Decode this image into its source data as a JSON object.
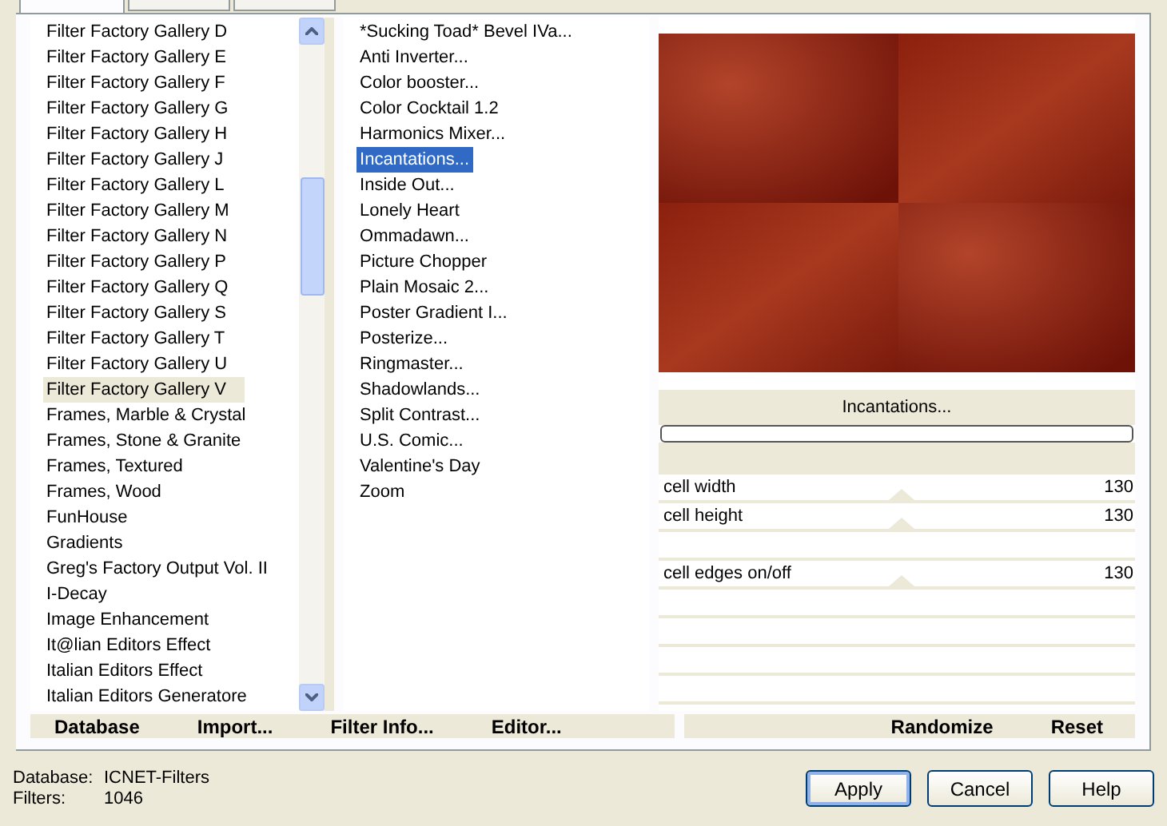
{
  "tabs": [
    {
      "selected": true
    },
    {
      "selected": false
    },
    {
      "selected": false
    }
  ],
  "categories": {
    "items": [
      {
        "label": "Filter Factory Gallery D",
        "selected": false
      },
      {
        "label": "Filter Factory Gallery E",
        "selected": false
      },
      {
        "label": "Filter Factory Gallery F",
        "selected": false
      },
      {
        "label": "Filter Factory Gallery G",
        "selected": false
      },
      {
        "label": "Filter Factory Gallery H",
        "selected": false
      },
      {
        "label": "Filter Factory Gallery J",
        "selected": false
      },
      {
        "label": "Filter Factory Gallery L",
        "selected": false
      },
      {
        "label": "Filter Factory Gallery M",
        "selected": false
      },
      {
        "label": "Filter Factory Gallery N",
        "selected": false
      },
      {
        "label": "Filter Factory Gallery P",
        "selected": false
      },
      {
        "label": "Filter Factory Gallery Q",
        "selected": false
      },
      {
        "label": "Filter Factory Gallery S",
        "selected": false
      },
      {
        "label": "Filter Factory Gallery T",
        "selected": false
      },
      {
        "label": "Filter Factory Gallery U",
        "selected": false
      },
      {
        "label": "Filter Factory Gallery V",
        "selected": true
      },
      {
        "label": "Frames, Marble & Crystal",
        "selected": false
      },
      {
        "label": "Frames, Stone & Granite",
        "selected": false
      },
      {
        "label": "Frames, Textured",
        "selected": false
      },
      {
        "label": "Frames, Wood",
        "selected": false
      },
      {
        "label": "FunHouse",
        "selected": false
      },
      {
        "label": "Gradients",
        "selected": false
      },
      {
        "label": "Greg's Factory Output Vol. II",
        "selected": false
      },
      {
        "label": "I-Decay",
        "selected": false
      },
      {
        "label": "Image Enhancement",
        "selected": false
      },
      {
        "label": "It@lian Editors Effect",
        "selected": false
      },
      {
        "label": "Italian Editors Effect",
        "selected": false
      },
      {
        "label": "Italian Editors Generatore",
        "selected": false
      }
    ]
  },
  "filters": {
    "items": [
      {
        "label": "*Sucking Toad*  Bevel IVa...",
        "selected": false
      },
      {
        "label": "Anti Inverter...",
        "selected": false
      },
      {
        "label": "Color booster...",
        "selected": false
      },
      {
        "label": "Color Cocktail 1.2",
        "selected": false
      },
      {
        "label": "Harmonics Mixer...",
        "selected": false
      },
      {
        "label": "Incantations...",
        "selected": true
      },
      {
        "label": "Inside Out...",
        "selected": false
      },
      {
        "label": "Lonely Heart",
        "selected": false
      },
      {
        "label": "Ommadawn...",
        "selected": false
      },
      {
        "label": "Picture Chopper",
        "selected": false
      },
      {
        "label": "Plain Mosaic 2...",
        "selected": false
      },
      {
        "label": "Poster Gradient I...",
        "selected": false
      },
      {
        "label": "Posterize...",
        "selected": false
      },
      {
        "label": "Ringmaster...",
        "selected": false
      },
      {
        "label": "Shadowlands...",
        "selected": false
      },
      {
        "label": "Split Contrast...",
        "selected": false
      },
      {
        "label": "U.S. Comic...",
        "selected": false
      },
      {
        "label": "Valentine's Day",
        "selected": false
      },
      {
        "label": "Zoom",
        "selected": false
      }
    ]
  },
  "preview": {
    "filter_name": "Incantations...",
    "progress": {
      "level": 0
    }
  },
  "parameters": [
    {
      "kind": "slider",
      "label": "cell width",
      "value": "130",
      "level": 0.51
    },
    {
      "kind": "slider",
      "label": "cell height",
      "value": "130",
      "level": 0.51
    },
    {
      "kind": "empty"
    },
    {
      "kind": "slider",
      "label": "cell edges on/off",
      "value": "130",
      "level": 0.51
    },
    {
      "kind": "empty"
    },
    {
      "kind": "empty"
    },
    {
      "kind": "empty"
    },
    {
      "kind": "empty"
    }
  ],
  "left_buttons": [
    "Database",
    "Import...",
    "Filter Info...",
    "Editor..."
  ],
  "right_buttons": [
    "Randomize",
    "Reset"
  ],
  "status": [
    {
      "label": "Database:",
      "value": "ICNET-Filters"
    },
    {
      "label": "Filters:",
      "value": "1046"
    }
  ],
  "dialog_buttons": [
    {
      "label": "Apply",
      "default": true
    },
    {
      "label": "Cancel",
      "default": false
    },
    {
      "label": "Help",
      "default": false
    }
  ]
}
